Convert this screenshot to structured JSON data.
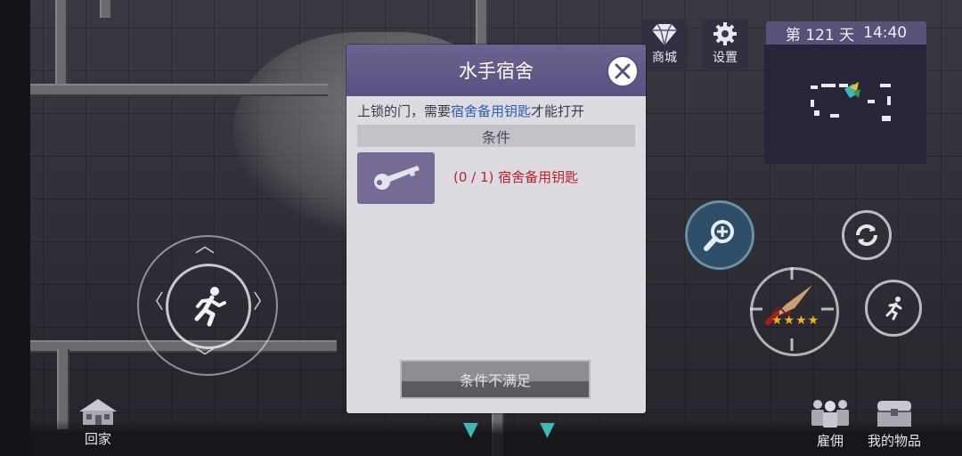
{
  "hud": {
    "shop_label": "商城",
    "settings_label": "设置",
    "day_prefix": "第",
    "day_number": "121",
    "day_suffix": "天",
    "time": "14:40",
    "home_label": "回家",
    "hire_label": "雇佣",
    "inventory_label": "我的物品",
    "weapon_stars": "★★★★"
  },
  "modal": {
    "title": "水手宿舍",
    "desc_prefix": "上锁的门，需要",
    "desc_item": "宿舍备用钥匙",
    "desc_suffix": "才能打开",
    "conditions_header": "条件",
    "conditions": [
      {
        "progress": "(0 / 1)",
        "item": "宿舍备用钥匙",
        "icon": "key-icon"
      }
    ],
    "submit_label": "条件不满足"
  },
  "colors": {
    "modal_header": "#5a5180",
    "highlight_text": "#2f5fb2",
    "unmet_text": "#c0222a",
    "accent_teal": "#3fb7b3",
    "star": "#f2b31a"
  }
}
